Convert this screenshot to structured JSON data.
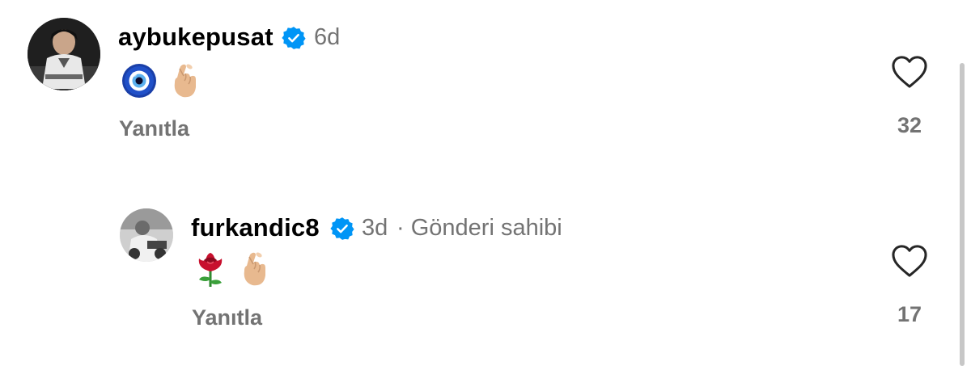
{
  "comments": [
    {
      "username": "aybukepusat",
      "verified": true,
      "time": "6d",
      "meta_extra": "",
      "emojis": [
        "nazar-amulet",
        "hand-with-index-finger-and-thumb-crossed"
      ],
      "reply_label": "Yanıtla",
      "likes": "32"
    },
    {
      "username": "furkandic8",
      "verified": true,
      "time": "3d",
      "meta_extra": "· Gönderi sahibi",
      "emojis": [
        "rose",
        "hand-with-index-finger-and-thumb-crossed"
      ],
      "reply_label": "Yanıtla",
      "likes": "17"
    }
  ],
  "colors": {
    "verified_blue": "#0095f6",
    "secondary_text": "#737373",
    "skin_tone": "#e8b98f",
    "scrollbar": "#c7c7c7"
  }
}
